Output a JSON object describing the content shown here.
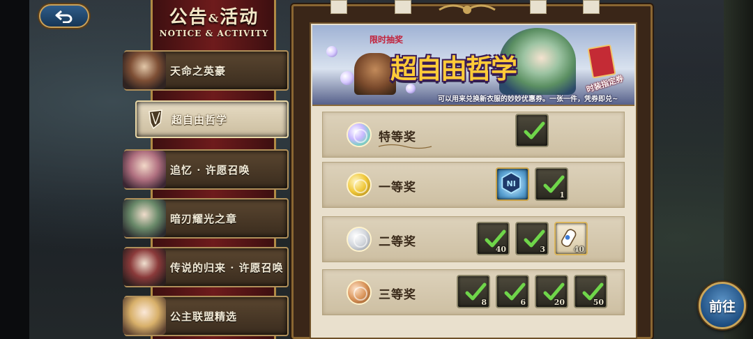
{
  "header": {
    "title_cn": "公告",
    "title_amp": "&",
    "title_cn2": "活动",
    "title_en": "NOTICE & ACTIVITY"
  },
  "menu": [
    {
      "label": "天命之英豪",
      "active": false
    },
    {
      "label": "超自由哲学",
      "active": true
    },
    {
      "label": "追忆 · 许愿召唤",
      "active": false
    },
    {
      "label": "暗刃耀光之章",
      "active": false
    },
    {
      "label": "传说的归来 · 许愿召唤",
      "active": false
    },
    {
      "label": "公主联盟精选",
      "active": false
    }
  ],
  "banner": {
    "tag": "限时抽奖",
    "title": "超自由哲学",
    "description": "可以用来兑换新衣服的妙妙优惠券。一张一件，凭券即兑~",
    "ticket_label": "时装指定券"
  },
  "prizes": [
    {
      "rank": "特等奖",
      "medal_color": "rainbow",
      "items": [
        {
          "icon": "checked-item-icon",
          "qty": ""
        }
      ]
    },
    {
      "rank": "一等奖",
      "medal_color": "gold",
      "items": [
        {
          "icon": "crystal-badge-icon",
          "qty": ""
        },
        {
          "icon": "checked-item-icon",
          "qty": "1"
        }
      ]
    },
    {
      "rank": "二等奖",
      "medal_color": "silver",
      "items": [
        {
          "icon": "checked-item-icon",
          "qty": "40"
        },
        {
          "icon": "checked-item-icon",
          "qty": "3"
        },
        {
          "icon": "scroll-item-icon",
          "qty": "40"
        }
      ]
    },
    {
      "rank": "三等奖",
      "medal_color": "bronze",
      "items": [
        {
          "icon": "checked-item-icon",
          "qty": "8"
        },
        {
          "icon": "checked-item-icon",
          "qty": "6"
        },
        {
          "icon": "checked-item-icon",
          "qty": "20"
        },
        {
          "icon": "checked-item-icon",
          "qty": "50"
        }
      ]
    }
  ],
  "go_button": {
    "label": "前往"
  },
  "colors": {
    "accent_gold": "#c9a55a",
    "check_green": "#6fd64a",
    "menu_active_bg": "#e7dcc4",
    "red_column": "#6e1b1c"
  }
}
